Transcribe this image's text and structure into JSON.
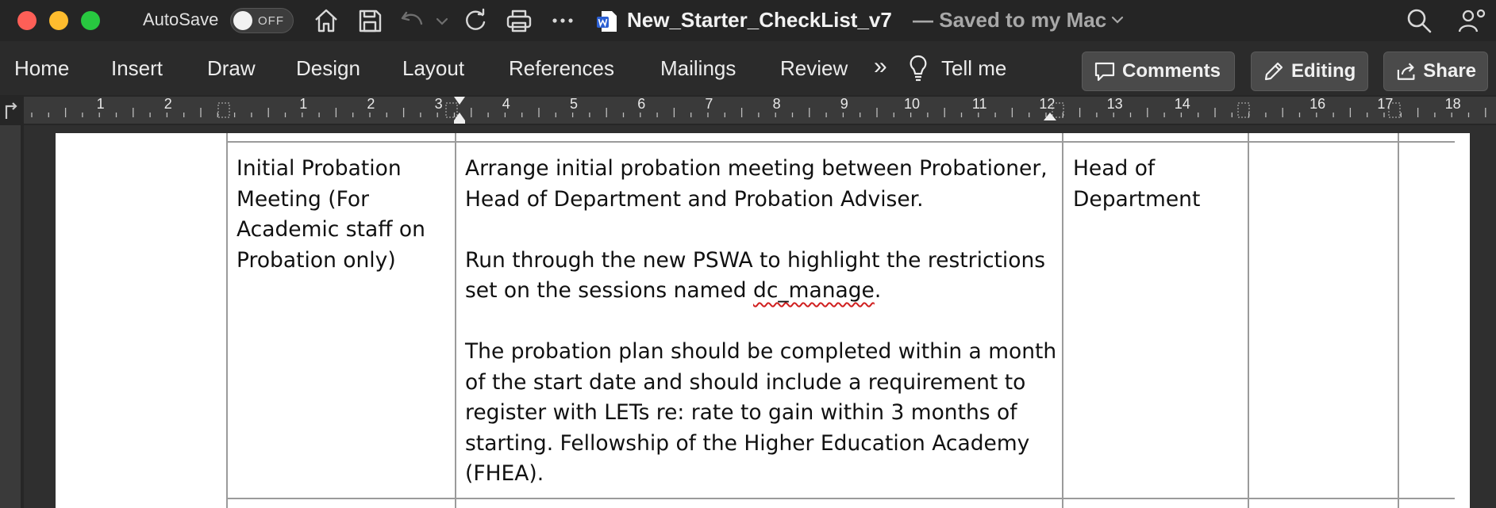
{
  "titlebar": {
    "autosave_label": "AutoSave",
    "autosave_state": "OFF",
    "document_name": "New_Starter_CheckList_v7",
    "save_status": "— Saved to my Mac",
    "icons": [
      "home-icon",
      "save-icon",
      "undo-icon",
      "chevron-down-icon",
      "redo-icon",
      "print-icon",
      "more-icon",
      "word-doc-icon",
      "search-icon",
      "account-icon"
    ]
  },
  "ribbon": {
    "tabs": [
      "Home",
      "Insert",
      "Draw",
      "Design",
      "Layout",
      "References",
      "Mailings",
      "Review"
    ],
    "overflow": "»",
    "tell_me": "Tell me",
    "comments_label": "Comments",
    "editing_label": "Editing",
    "share_label": "Share"
  },
  "ruler": {
    "labels_left": [
      "2",
      "1"
    ],
    "labels_main": [
      "1",
      "2",
      "3",
      "4",
      "5",
      "6",
      "7",
      "8",
      "9",
      "10",
      "11",
      "12"
    ],
    "labels_right": [
      "13",
      "14",
      "16",
      "17",
      "18"
    ]
  },
  "table": {
    "row": {
      "activity": "Initial Probation Meeting (For Academic staff on Probation only)",
      "activity_lines": [
        "Initial Probation",
        "Meeting (For",
        "Academic staff on",
        "Probation only)"
      ],
      "paragraph1_lines": [
        "Arrange initial probation meeting between Probationer,",
        "Head of Department and Probation Adviser."
      ],
      "paragraph2_lines": [
        "Run through the new PSWA to highlight the restrictions",
        "set on the sessions named "
      ],
      "paragraph2_term": "dc_manage",
      "paragraph2_end": ".",
      "paragraph3_lines": [
        "The probation plan should be completed within a month",
        "of the start date and should include a requirement to",
        "register with LETs re: rate to gain within 3 months of",
        "starting. Fellowship of the Higher Education Academy",
        "(FHEA)."
      ],
      "responsible_lines": [
        "Head of",
        "Department"
      ],
      "completed": ""
    }
  },
  "colors": {
    "titlebar_bg": "#252525",
    "ribbon_bg": "#2b2b2b",
    "page_bg": "#ffffff",
    "spell_error": "#d02020"
  }
}
